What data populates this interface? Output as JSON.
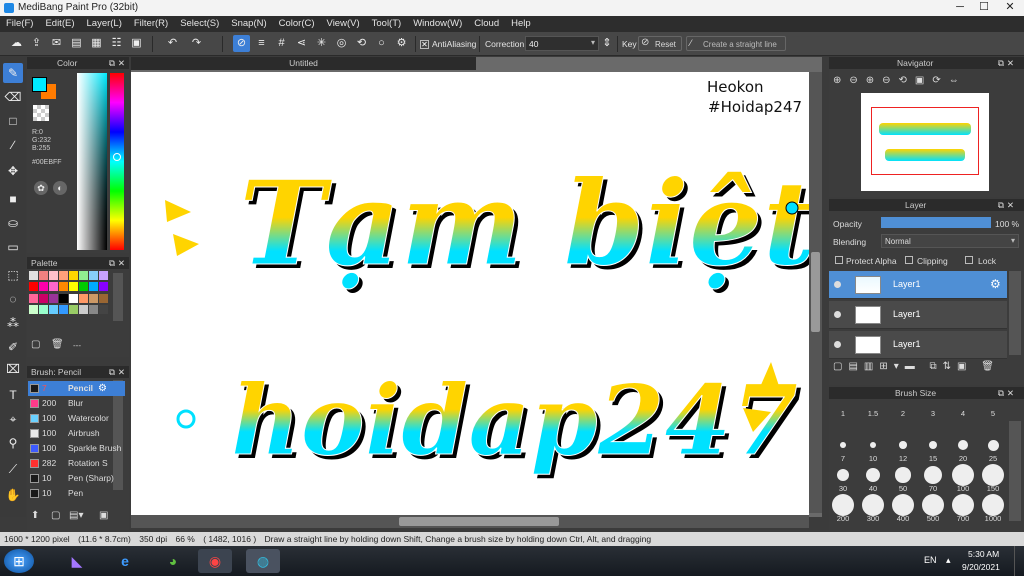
{
  "app": {
    "title": "MediBang Paint Pro (32bit)"
  },
  "window_controls": {
    "minimize": "─",
    "maximize": "☐",
    "close": "✕"
  },
  "menu": [
    "File(F)",
    "Edit(E)",
    "Layer(L)",
    "Filter(R)",
    "Select(S)",
    "Snap(N)",
    "Color(C)",
    "View(V)",
    "Tool(T)",
    "Window(W)",
    "Cloud",
    "Help"
  ],
  "toolbar": {
    "antialiasing_label": "AntiAliasing",
    "correction_label": "Correction",
    "correction_value": "40",
    "key_label": "Key",
    "reset_label": "Reset",
    "straight_line_label": "Create a straight line"
  },
  "color_panel": {
    "title": "Color",
    "r": "R:0",
    "g": "G:232",
    "b": "B:255",
    "hex": "#00EBFF"
  },
  "palette_panel": {
    "title": "Palette",
    "dashes": "---"
  },
  "brush_panel": {
    "title": "Brush: Pencil",
    "items": [
      {
        "size": "7",
        "name": "Pencil",
        "color": "#1a1a1a"
      },
      {
        "size": "200",
        "name": "Blur",
        "color": "#ff3b8a"
      },
      {
        "size": "100",
        "name": "Watercolor",
        "color": "#6ad1ff"
      },
      {
        "size": "100",
        "name": "Airbrush",
        "color": "#e8e8e8"
      },
      {
        "size": "100",
        "name": "Sparkle Brush",
        "color": "#3d5bff"
      },
      {
        "size": "282",
        "name": "Rotation S",
        "color": "#ff3030"
      },
      {
        "size": "10",
        "name": "Pen (Sharp)",
        "color": "#1a1a1a"
      },
      {
        "size": "10",
        "name": "Pen",
        "color": "#1a1a1a"
      }
    ]
  },
  "document": {
    "tab_title": "Untitled"
  },
  "canvas_text": {
    "watermark_line1": "Heokon",
    "watermark_line2": "#Hoidap247",
    "art_line1": "Tạm biệt",
    "art_line2": "hoidap247"
  },
  "navigator": {
    "title": "Navigator"
  },
  "layer_panel": {
    "title": "Layer",
    "opacity_label": "Opacity",
    "opacity_value": "100 %",
    "opacity_fraction": 1.0,
    "blending_label": "Blending",
    "blending_value": "Normal",
    "protect_alpha": "Protect Alpha",
    "clipping": "Clipping",
    "lock": "Lock",
    "layers": [
      {
        "name": "Layer1",
        "selected": true
      },
      {
        "name": "Layer1",
        "selected": false
      },
      {
        "name": "Layer1",
        "selected": false
      }
    ]
  },
  "brush_size_panel": {
    "title": "Brush Size",
    "sizes": [
      "1",
      "1.5",
      "2",
      "3",
      "4",
      "5",
      "7",
      "10",
      "12",
      "15",
      "20",
      "25",
      "30",
      "40",
      "50",
      "70",
      "100",
      "150",
      "200",
      "300",
      "400",
      "500",
      "700",
      "1000"
    ]
  },
  "status": {
    "size": "1600 * 1200 pixel",
    "physical": "(11.6 * 8.7cm)",
    "dpi": "350 dpi",
    "zoom": "66 %",
    "coords": "( 1482, 1016 )",
    "hint": "Draw a straight line by holding down Shift, Change a brush size by holding down Ctrl, Alt, and dragging"
  },
  "taskbar": {
    "lang": "EN",
    "time": "5:30 AM",
    "date": "9/20/2021"
  },
  "colors": {
    "accent": "#3d7fd6",
    "art_yellow": "#ffd400",
    "art_cyan": "#00e1ff",
    "main_color": "#00EBFF",
    "sub_color": "#ff7b00"
  }
}
